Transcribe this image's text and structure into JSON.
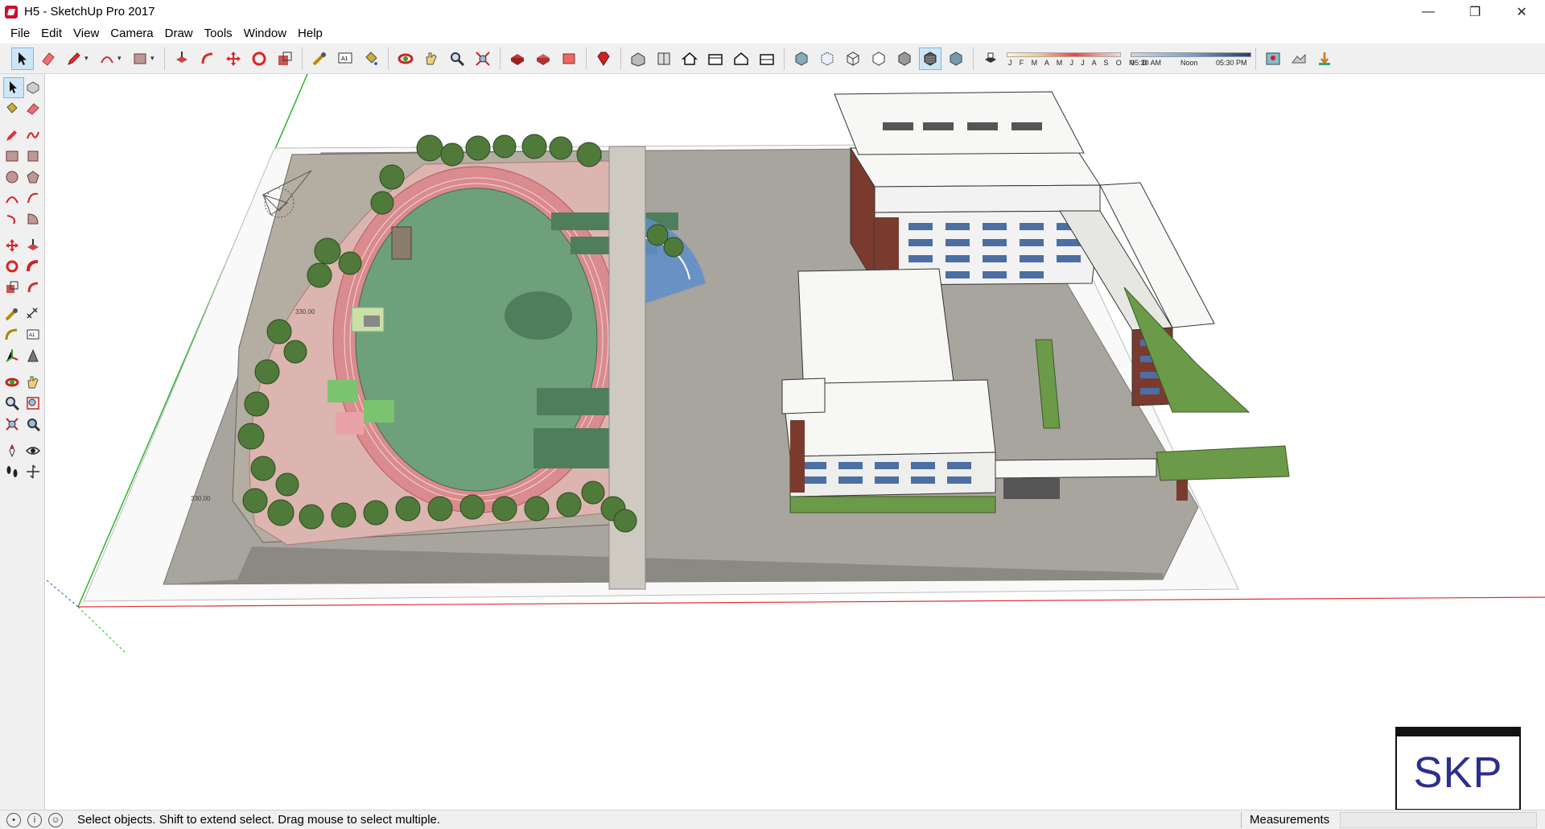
{
  "window": {
    "title": "H5 - SketchUp Pro 2017",
    "minimize": "—",
    "maximize": "❐",
    "close": "✕"
  },
  "menu": [
    "File",
    "Edit",
    "View",
    "Camera",
    "Draw",
    "Tools",
    "Window",
    "Help"
  ],
  "shadow": {
    "months_label": "J F M A M J J A S O N D",
    "time_start": "05:30 AM",
    "time_mid": "Noon",
    "time_end": "05:30 PM"
  },
  "viewport": {
    "elevation_labels": [
      "330.00",
      "330.00"
    ]
  },
  "badge": {
    "text": "SKP"
  },
  "status": {
    "message": "Select objects. Shift to extend select. Drag mouse to select multiple.",
    "measurements_label": "Measurements",
    "measurements_value": ""
  },
  "colors": {
    "field_green": "#6fa07c",
    "track_red": "#d98b8e",
    "ground_gray": "#a8a59e",
    "roof_white": "#f7f7f5",
    "brick": "#7a3b2e",
    "tree_green": "#4f7a3a",
    "axis_green": "#2bb52b",
    "axis_red": "#e03030"
  }
}
